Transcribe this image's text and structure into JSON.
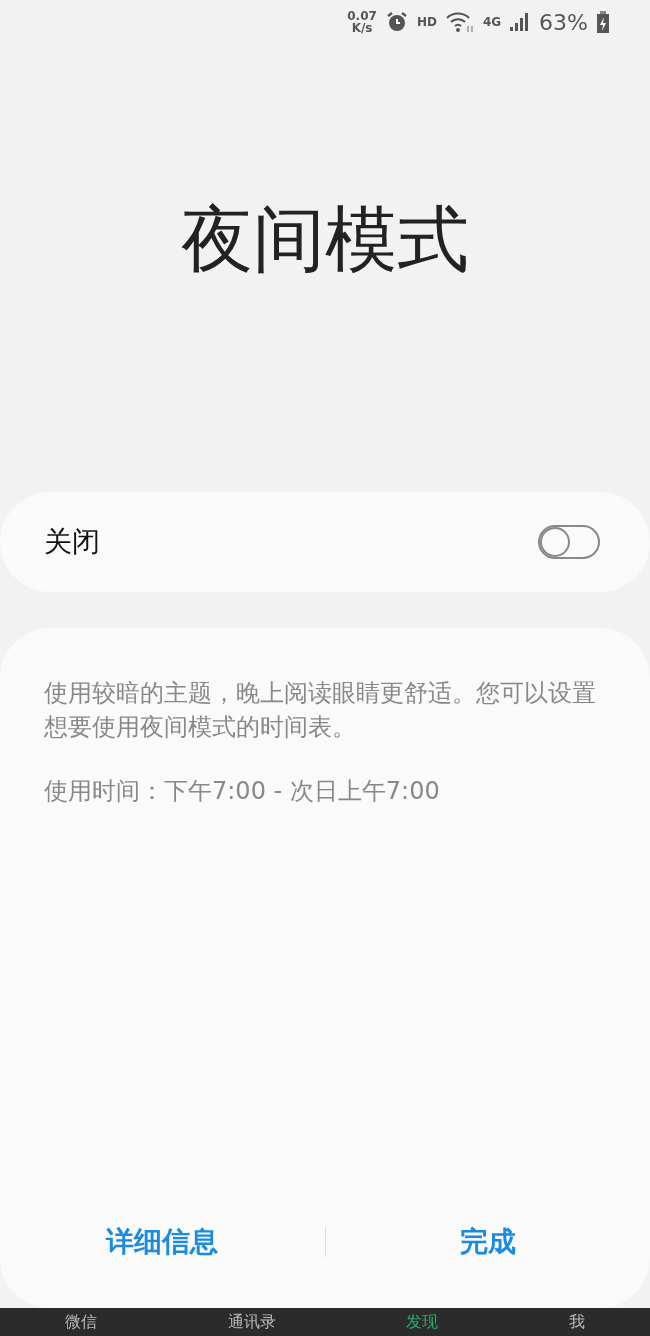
{
  "status_bar": {
    "speed": "0.07",
    "speed_unit": "K/s",
    "hd": "HD",
    "network": "4G",
    "battery": "63%"
  },
  "title": "夜间模式",
  "toggle": {
    "label": "关闭",
    "on": false
  },
  "description": "使用较暗的主题，晚上阅读眼睛更舒适。您可以设置想要使用夜间模式的时间表。",
  "schedule": "使用时间：下午7:00 - 次日上午7:00",
  "buttons": [
    "详细信息",
    "完成"
  ],
  "bottom_tabs": [
    {
      "label": "微信",
      "selected": false
    },
    {
      "label": "通讯录",
      "selected": false
    },
    {
      "label": "发现",
      "selected": true
    },
    {
      "label": "我",
      "selected": false
    }
  ]
}
